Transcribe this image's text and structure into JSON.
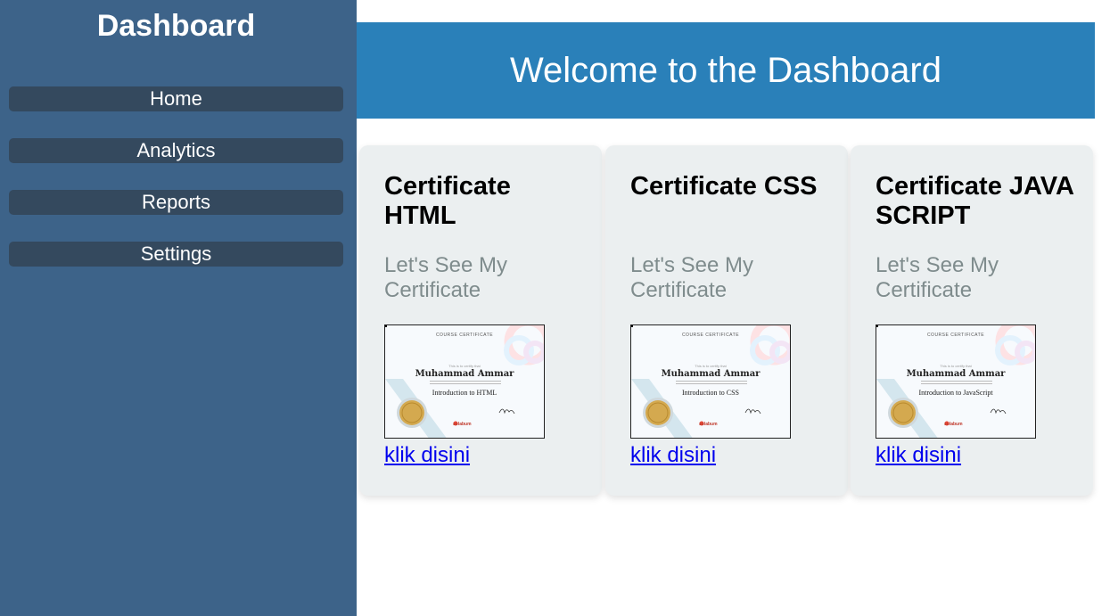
{
  "sidebar": {
    "title": "Dashboard",
    "items": [
      {
        "label": "Home"
      },
      {
        "label": "Analytics"
      },
      {
        "label": "Reports"
      },
      {
        "label": "Settings"
      }
    ]
  },
  "header": {
    "title": "Welcome to the Dashboard"
  },
  "cards": [
    {
      "title": "Certificate HTML",
      "subtitle": "Let's See My Certificate",
      "link": "klik disini",
      "cert": {
        "heading": "COURSE CERTIFICATE",
        "presented": "This is to certify that",
        "name": "Muhammad Ammar",
        "course": "Introduction to HTML",
        "brand": "solabum"
      }
    },
    {
      "title": "Certificate CSS",
      "subtitle": "Let's See My Certificate",
      "link": "klik disini",
      "cert": {
        "heading": "COURSE CERTIFICATE",
        "presented": "This is to certify that",
        "name": "Muhammad Ammar",
        "course": "Introduction to CSS",
        "brand": "solabum"
      }
    },
    {
      "title": "Certificate JAVA SCRIPT",
      "subtitle": "Let's See My Certificate",
      "link": "klik disini",
      "cert": {
        "heading": "COURSE CERTIFICATE",
        "presented": "This is to certify that",
        "name": "Muhammad Ammar",
        "course": "Introduction to JavaScript",
        "brand": "solabum"
      }
    }
  ],
  "colors": {
    "sidebar_bg": "#3d6389",
    "nav_item_bg": "#34495e",
    "header_bg": "#2a80b9",
    "card_bg": "#ebeff0",
    "subtitle_text": "#7f8c8d",
    "link_text": "#0000ee"
  }
}
